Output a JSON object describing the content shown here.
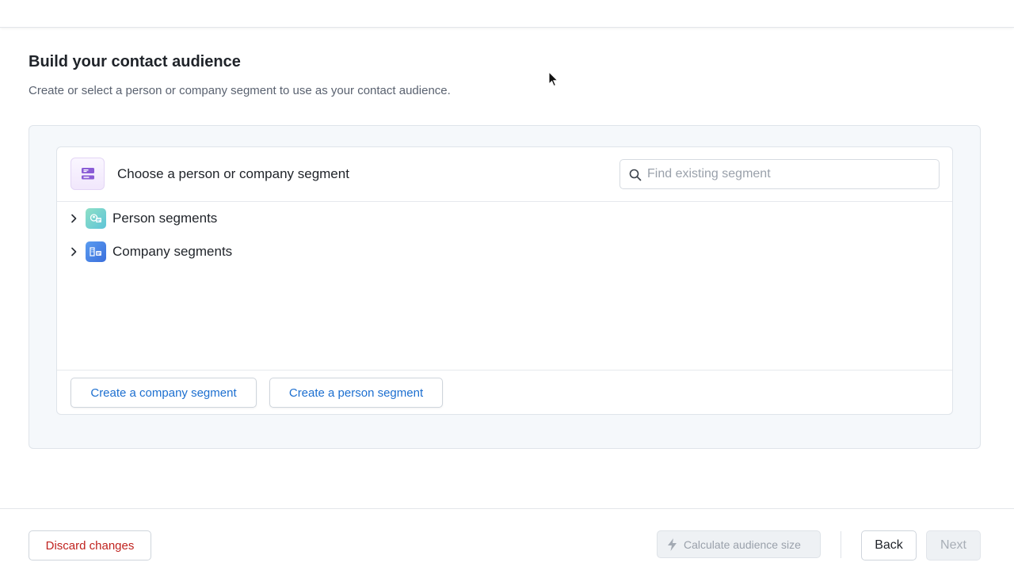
{
  "page": {
    "title": "Build your contact audience",
    "subtitle": "Create or select a person or company segment to use as your contact audience."
  },
  "segment_picker": {
    "header_title": "Choose a person or company segment",
    "search_placeholder": "Find existing segment",
    "search_value": "",
    "header_icon": "segment-list-icon",
    "groups": [
      {
        "label": "Person segments",
        "icon": "person-segment-icon",
        "expanded": false
      },
      {
        "label": "Company segments",
        "icon": "company-segment-icon",
        "expanded": false
      }
    ],
    "footer_buttons": {
      "create_company": "Create a company segment",
      "create_person": "Create a person segment"
    }
  },
  "footer": {
    "discard_label": "Discard changes",
    "calculate_label": "Calculate audience size",
    "back_label": "Back",
    "next_label": "Next"
  },
  "colors": {
    "accent": "#1c6fd0",
    "danger": "#c0231f",
    "panel_bg": "#f5f8fb"
  }
}
